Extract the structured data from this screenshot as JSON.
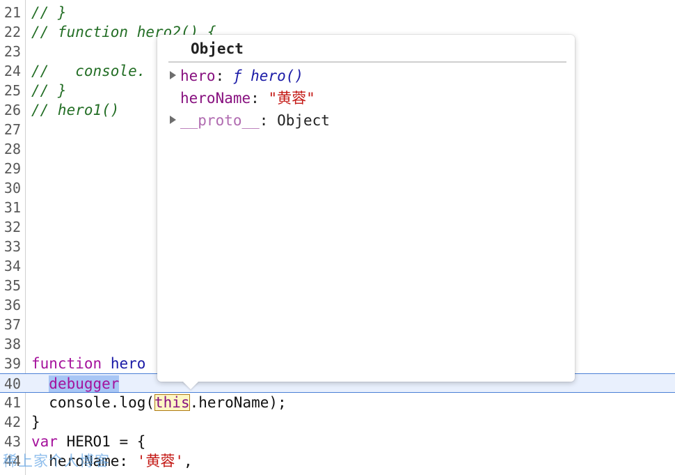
{
  "editor": {
    "lines": [
      {
        "num": "21",
        "parts": [
          {
            "t": "// }",
            "c": "cm"
          }
        ]
      },
      {
        "num": "22",
        "parts": [
          {
            "t": "// function hero2() {",
            "c": "cm"
          }
        ]
      },
      {
        "num": "23",
        "parts": []
      },
      {
        "num": "24",
        "parts": [
          {
            "t": "//   console.",
            "c": "cm"
          }
        ]
      },
      {
        "num": "25",
        "parts": [
          {
            "t": "// }",
            "c": "cm"
          }
        ]
      },
      {
        "num": "26",
        "parts": [
          {
            "t": "// hero1()",
            "c": "cm"
          }
        ]
      },
      {
        "num": "27",
        "parts": []
      },
      {
        "num": "28",
        "parts": []
      },
      {
        "num": "29",
        "parts": []
      },
      {
        "num": "30",
        "parts": []
      },
      {
        "num": "31",
        "parts": []
      },
      {
        "num": "32",
        "parts": []
      },
      {
        "num": "33",
        "parts": []
      },
      {
        "num": "34",
        "parts": []
      },
      {
        "num": "35",
        "parts": []
      },
      {
        "num": "36",
        "parts": []
      },
      {
        "num": "37",
        "parts": []
      },
      {
        "num": "38",
        "parts": []
      },
      {
        "num": "39",
        "parts": [
          {
            "t": "function",
            "c": "kw"
          },
          {
            "t": " "
          },
          {
            "t": "hero",
            "c": "fn"
          }
        ]
      },
      {
        "num": "40",
        "exec": true,
        "parts": [
          {
            "t": "  "
          },
          {
            "t": "debugger",
            "c": "kw hl-blue"
          }
        ]
      },
      {
        "num": "41",
        "parts": [
          {
            "t": "  console.log("
          },
          {
            "t": "this",
            "c": "hl-this"
          },
          {
            "t": ".heroName);"
          }
        ]
      },
      {
        "num": "42",
        "parts": [
          {
            "t": "}"
          }
        ]
      },
      {
        "num": "43",
        "parts": [
          {
            "t": "var",
            "c": "kw"
          },
          {
            "t": " HERO1 = {"
          }
        ]
      },
      {
        "num": "44",
        "parts": [
          {
            "t": "  heroName: "
          },
          {
            "t": "'黄蓉'",
            "c": "str"
          },
          {
            "t": ","
          }
        ]
      }
    ],
    "watermark": "稀上家个人博客"
  },
  "popover": {
    "title": "Object",
    "properties": [
      {
        "key": "hero",
        "sep": ": ",
        "value": "ƒ hero()",
        "value_type": "function",
        "expandable": true,
        "dim": false
      },
      {
        "key": "heroName",
        "sep": ": ",
        "value": "\"黄蓉\"",
        "value_type": "string",
        "expandable": false,
        "dim": false
      },
      {
        "key": "__proto__",
        "sep": ": ",
        "value": "Object",
        "value_type": "object",
        "expandable": true,
        "dim": true
      }
    ]
  },
  "colors": {
    "comment": "#236e25",
    "keyword": "#a5129c",
    "function": "#1a1aa6",
    "string": "#c41a16",
    "exec_line_bg": "#e9f0fd",
    "exec_line_border": "#4a7fd6"
  }
}
